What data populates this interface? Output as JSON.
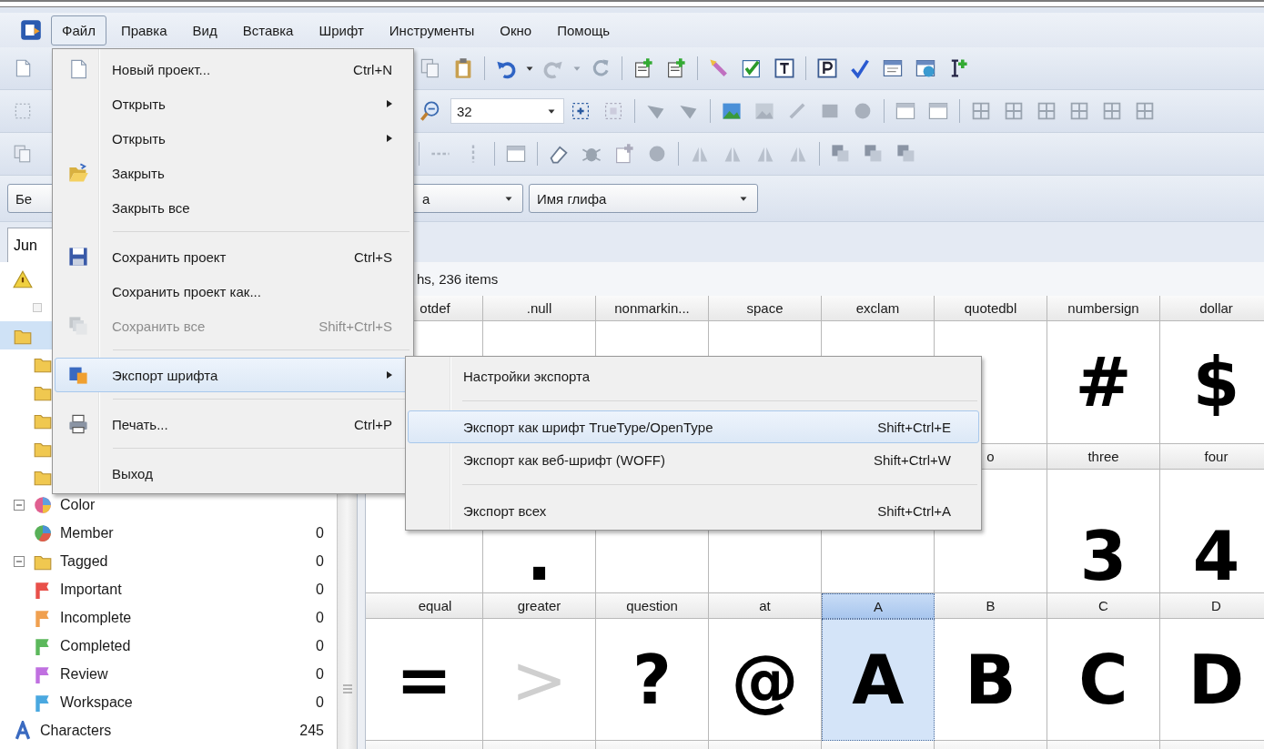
{
  "menubar": {
    "items": [
      {
        "label": "Файл",
        "selected": true
      },
      {
        "label": "Правка",
        "selected": false
      },
      {
        "label": "Вид",
        "selected": false
      },
      {
        "label": "Вставка",
        "selected": false
      },
      {
        "label": "Шрифт",
        "selected": false
      },
      {
        "label": "Инструменты",
        "selected": false
      },
      {
        "label": "Окно",
        "selected": false
      },
      {
        "label": "Помощь",
        "selected": false
      }
    ]
  },
  "toolbar": {
    "zoom_value": "32",
    "font_combo": "Бе",
    "glyph_combo": "а",
    "glyph_name_combo": "Имя глифа"
  },
  "panel_tab": {
    "label": "Jun"
  },
  "tree": [
    {
      "kind": "warning",
      "selected": false,
      "children": [
        {
          "kind": "blank",
          "selected": false
        }
      ]
    },
    {
      "kind": "folder",
      "selected": true,
      "children": [
        {
          "kind": "folder",
          "selected": false
        },
        {
          "kind": "folder",
          "selected": false
        },
        {
          "kind": "folder",
          "selected": false
        },
        {
          "kind": "folder",
          "selected": false
        },
        {
          "kind": "folder",
          "selected": false
        }
      ]
    },
    {
      "kind": "wheel",
      "label": "Color",
      "selected": false,
      "expanded": true,
      "children": [
        {
          "kind": "pie",
          "label": "Member",
          "count": "0",
          "selected": false
        }
      ]
    },
    {
      "kind": "folder",
      "label": "Tagged",
      "count": "0",
      "selected": false,
      "expanded": true,
      "children": [
        {
          "kind": "flag",
          "label": "Important",
          "count": "0",
          "color": "#e8504a",
          "selected": false
        },
        {
          "kind": "flag",
          "label": "Incomplete",
          "count": "0",
          "color": "#f0a050",
          "selected": false
        },
        {
          "kind": "flag",
          "label": "Completed",
          "count": "0",
          "color": "#5cb85c",
          "selected": false
        },
        {
          "kind": "flag",
          "label": "Review",
          "count": "0",
          "color": "#c070e0",
          "selected": false
        },
        {
          "kind": "flag",
          "label": "Workspace",
          "count": "0",
          "color": "#4aa8e0",
          "selected": false
        }
      ]
    },
    {
      "kind": "characters",
      "label": "Characters",
      "count": "245",
      "selected": false
    }
  ],
  "glyphs": {
    "summary": "hs, 236 items",
    "rows": [
      {
        "cells": [
          {
            "name": "otdef",
            "selected": false
          },
          {
            "name": ".null",
            "selected": false
          },
          {
            "name": "nonmarkin...",
            "selected": false
          },
          {
            "name": "space",
            "selected": false
          },
          {
            "name": "exclam",
            "selected": false
          },
          {
            "name": "quotedbl",
            "selected": false
          },
          {
            "name": "numbersign",
            "glyph": "#",
            "empty": false,
            "selected": false
          },
          {
            "name": "dollar",
            "glyph": "$",
            "empty": false,
            "selected": false
          }
        ]
      },
      {
        "cells": [
          {
            "selected": false
          },
          {
            "glyph": ".",
            "empty": false,
            "selected": false
          },
          {
            "selected": false
          },
          {
            "selected": false
          },
          {
            "selected": false
          },
          {
            "name": "o",
            "selected": false
          },
          {
            "name": "three",
            "glyph": "3",
            "empty": false,
            "selected": false
          },
          {
            "name": "four",
            "glyph": "4",
            "empty": false,
            "selected": false
          }
        ]
      },
      {
        "cells": [
          {
            "name": "equal",
            "glyph": "=",
            "empty": false,
            "selected": false
          },
          {
            "name": "greater",
            "glyph": ">",
            "empty": true,
            "selected": false
          },
          {
            "name": "question",
            "glyph": "?",
            "empty": false,
            "selected": false
          },
          {
            "name": "at",
            "glyph": "@",
            "empty": false,
            "selected": false
          },
          {
            "name": "A",
            "glyph": "A",
            "empty": false,
            "selected": true
          },
          {
            "name": "B",
            "glyph": "B",
            "empty": false,
            "selected": false
          },
          {
            "name": "C",
            "glyph": "C",
            "empty": false,
            "selected": false
          },
          {
            "name": "D",
            "glyph": "D",
            "empty": false,
            "selected": false
          }
        ]
      }
    ]
  },
  "file_menu": {
    "items": [
      {
        "kind": "item",
        "label": "Новый проект...",
        "shortcut": "Ctrl+N",
        "disabled": false,
        "selected": false,
        "submenu": false
      },
      {
        "kind": "item",
        "label": "Открыть",
        "disabled": false,
        "selected": false,
        "submenu": true
      },
      {
        "kind": "item",
        "label": "Открыть",
        "disabled": false,
        "selected": false,
        "submenu": true
      },
      {
        "kind": "item",
        "label": "Закрыть",
        "disabled": false,
        "selected": false,
        "submenu": false
      },
      {
        "kind": "item",
        "label": "Закрыть все",
        "disabled": false,
        "selected": false,
        "submenu": false
      },
      {
        "kind": "separator"
      },
      {
        "kind": "item",
        "label": "Сохранить проект",
        "shortcut": "Ctrl+S",
        "disabled": false,
        "selected": false,
        "submenu": false
      },
      {
        "kind": "item",
        "label": "Сохранить проект как...",
        "disabled": false,
        "selected": false,
        "submenu": false
      },
      {
        "kind": "item",
        "label": "Сохранить все",
        "shortcut": "Shift+Ctrl+S",
        "disabled": true,
        "selected": false,
        "submenu": false
      },
      {
        "kind": "separator"
      },
      {
        "kind": "item",
        "label": "Экспорт шрифта",
        "disabled": false,
        "selected": true,
        "submenu": true
      },
      {
        "kind": "separator"
      },
      {
        "kind": "item",
        "label": "Печать...",
        "shortcut": "Ctrl+P",
        "disabled": false,
        "selected": false,
        "submenu": false
      },
      {
        "kind": "separator"
      },
      {
        "kind": "item",
        "label": "Выход",
        "disabled": false,
        "selected": false,
        "submenu": false
      }
    ]
  },
  "export_submenu": {
    "items": [
      {
        "kind": "item",
        "label": "Настройки экспорта",
        "disabled": false,
        "selected": false,
        "submenu": false
      },
      {
        "kind": "separator"
      },
      {
        "kind": "item",
        "label": "Экспорт как шрифт TrueType/OpenType",
        "shortcut": "Shift+Ctrl+E",
        "disabled": false,
        "selected": true,
        "submenu": false
      },
      {
        "kind": "item",
        "label": "Экспорт как веб-шрифт (WOFF)",
        "shortcut": "Shift+Ctrl+W",
        "disabled": false,
        "selected": false,
        "submenu": false
      },
      {
        "kind": "separator"
      },
      {
        "kind": "item",
        "label": "Экспорт всех",
        "shortcut": "Shift+Ctrl+A",
        "disabled": false,
        "selected": false,
        "submenu": false
      }
    ]
  }
}
